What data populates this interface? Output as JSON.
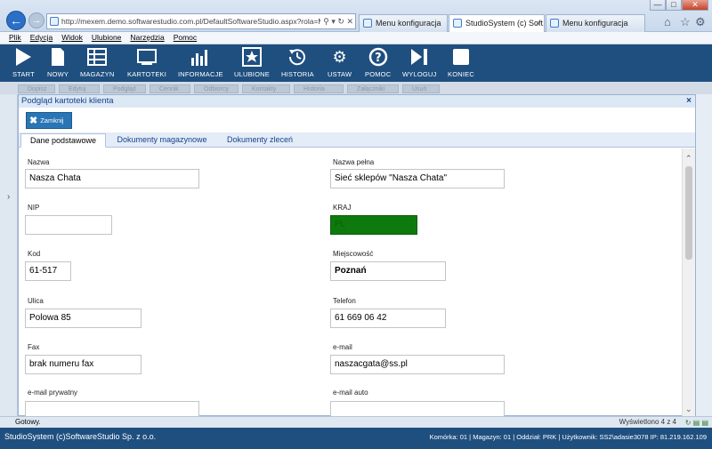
{
  "browser": {
    "address": "http://mexem.demo.softwarestudio.com.pl/DefaultSoftwareStudio.aspx?rola=MI",
    "tabs": [
      {
        "label": "Menu konfiguracja",
        "active": false
      },
      {
        "label": "StudioSystem (c) Soft...",
        "active": true
      },
      {
        "label": "Menu konfiguracja",
        "active": false
      }
    ],
    "window_controls": [
      "—",
      "□",
      "✕"
    ]
  },
  "menu": {
    "items": [
      "Plik",
      "Edycja",
      "Widok",
      "Ulubione",
      "Narzędzia",
      "Pomoc"
    ]
  },
  "toolbar": {
    "items": [
      {
        "label": "START",
        "icon": "play-icon"
      },
      {
        "label": "NOWY",
        "icon": "new-document-icon"
      },
      {
        "label": "MAGAZYN",
        "icon": "warehouse-icon"
      },
      {
        "label": "KARTOTEKI",
        "icon": "card-file-icon"
      },
      {
        "label": "INFORMACJE",
        "icon": "bar-chart-icon"
      },
      {
        "label": "ULUBIONE",
        "icon": "star-icon"
      },
      {
        "label": "HISTORIA",
        "icon": "history-icon"
      },
      {
        "label": "USTAW",
        "icon": "gears-icon"
      },
      {
        "label": "POMOC",
        "icon": "help-icon"
      },
      {
        "label": "WYLOGUJ",
        "icon": "logout-icon"
      },
      {
        "label": "KONIEC",
        "icon": "stop-icon"
      }
    ]
  },
  "subbar": {
    "items": [
      "Dopisz",
      "Edytuj",
      "Podgląd",
      "Cennik",
      "Odbiorcy",
      "Kontakty",
      "Historia",
      "Załączniki",
      "Usuń"
    ]
  },
  "dialog": {
    "title": "Podgląd kartoteki klienta",
    "close_button": "Zamknij",
    "tabs": [
      "Dane podstawowe",
      "Dokumenty magazynowe",
      "Dokumenty zleceń"
    ],
    "fields": {
      "nazwa": {
        "label": "Nazwa",
        "value": "Nasza Chata"
      },
      "nazwa_pelna": {
        "label": "Nazwa pełna",
        "value": "Sieć sklepów \"Nasza Chata\""
      },
      "nip": {
        "label": "NIP",
        "value": ""
      },
      "kraj": {
        "label": "KRAJ",
        "value": "PL"
      },
      "kod": {
        "label": "Kod",
        "value": "61-517"
      },
      "miejscowosc": {
        "label": "Miejscowość",
        "value": "Poznań"
      },
      "ulica": {
        "label": "Ulica",
        "value": "Polowa 85"
      },
      "telefon": {
        "label": "Telefon",
        "value": "61 669 06 42"
      },
      "fax": {
        "label": "Fax",
        "value": "brak numeru fax"
      },
      "email": {
        "label": "e-mail",
        "value": "naszacgata@ss.pl"
      },
      "email_prywatny": {
        "label": "e-mail prywatny",
        "value": ""
      },
      "email_auto": {
        "label": "e-mail auto",
        "value": ""
      }
    }
  },
  "status": {
    "left": "Gotowy.",
    "right": "Wyświetlono 4 z 4"
  },
  "footer": {
    "left": "StudioSystem (c)SoftwareStudio Sp. z o.o.",
    "right": "Komórka: 01 | Magazyn: 01 | Oddział: PRK | Użytkownik: SS2\\adasie3078 IP: 81.219.162.109"
  },
  "colors": {
    "toolbar": "#1f4f7f",
    "kraj_field": "#0e7a0e",
    "dialog_accent": "#15428b"
  }
}
